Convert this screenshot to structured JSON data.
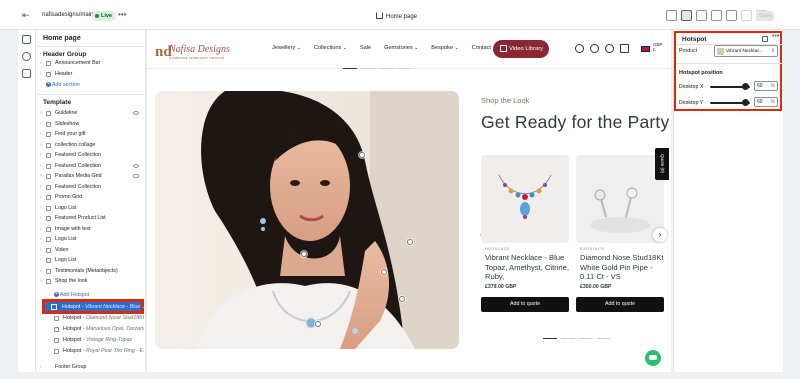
{
  "topbar": {
    "store": "nafisadesigns/main",
    "live": "Live",
    "more": "•••",
    "page_title": "Home page",
    "save": "Save"
  },
  "sidebar": {
    "title": "Home page",
    "header_group": "Header Group",
    "header_items": [
      {
        "label": "Announcement Bar"
      },
      {
        "label": "Header"
      }
    ],
    "add_section": "Add section",
    "template": "Template",
    "template_items": [
      {
        "label": "Guideline",
        "eye": true
      },
      {
        "label": "Slideshow",
        "eye": false
      },
      {
        "label": "Find your gift",
        "eye": false
      },
      {
        "label": "collection collage",
        "eye": false
      },
      {
        "label": "Featured Collection",
        "eye": false
      },
      {
        "label": "Featured Collection",
        "eye": true
      },
      {
        "label": "Parallax Media Grid",
        "eye": true
      },
      {
        "label": "Featured Collection",
        "eye": false
      },
      {
        "label": "Promo Grid",
        "eye": false
      },
      {
        "label": "Logo List",
        "eye": false
      },
      {
        "label": "Featured Product List",
        "eye": false
      },
      {
        "label": "Image with text",
        "eye": false
      },
      {
        "label": "Logo List",
        "eye": false
      },
      {
        "label": "Video",
        "eye": false
      },
      {
        "label": "Logo List",
        "eye": false
      },
      {
        "label": "Testimonials (Metaobjects)",
        "eye": false
      },
      {
        "label": "Shop the look",
        "eye": false
      }
    ],
    "add_hotspot": "Add Hotspot",
    "selected_hotspot": {
      "label": "Hotspot",
      "sub": " - Vibrant Necklace - Blue ..."
    },
    "hotspots": [
      {
        "label": "Hotspot",
        "sub": " - Diamond Nose Stud18Kt..."
      },
      {
        "label": "Hotspot",
        "sub": " - Marvelous Opal, Tanzani..."
      },
      {
        "label": "Hotspot",
        "sub": " - Vintage Ring-Topaz"
      },
      {
        "label": "Hotspot",
        "sub": " - Royal Pear Trio Ring - E..."
      }
    ],
    "footer_group": "Footer Group"
  },
  "site": {
    "logo_text": "Nafisa Designs",
    "logo_mark": "nd",
    "logo_tag": "HANDMADE JEWELLERY DESIGNS",
    "nav": [
      {
        "label": "Jewellery",
        "dropdown": true
      },
      {
        "label": "Collections",
        "dropdown": true
      },
      {
        "label": "Sale",
        "dropdown": false
      },
      {
        "label": "Gemstones",
        "dropdown": true
      },
      {
        "label": "Bespoke",
        "dropdown": true
      },
      {
        "label": "Contact",
        "dropdown": false
      }
    ],
    "video_library": "Video Library",
    "currency": "GBP\n£",
    "shop_the_look": "Shop the Look",
    "heading": "Get Ready for the Party",
    "products": [
      {
        "category": "NECKLACE",
        "name": "Vibrant Necklace - Blue Topaz, Amethyst, Citrine, Ruby,",
        "price": "£379.00 GBP",
        "cta": "Add to quote"
      },
      {
        "category": "EARRINGS",
        "name": "Diamond Nose Stud18Kt White Gold Pin Pipe - 0.11 Ct - VS",
        "price": "£350.00 GBP",
        "cta": "Add to quote"
      }
    ],
    "quote_tab": "Quote (0)"
  },
  "panel": {
    "title": "Hotspot",
    "product_label": "Product",
    "product_value": "Vibrant Necklac...",
    "position_title": "Hotspot position",
    "desktop_x_label": "Desktop X",
    "desktop_x": "60",
    "desktop_y_label": "Desktop Y",
    "desktop_y": "60",
    "unit": "%"
  },
  "colors": {
    "brand": "#8b2634",
    "selection": "#2c6ecb",
    "highlight": "#d72c0d",
    "live": "#29845a"
  }
}
